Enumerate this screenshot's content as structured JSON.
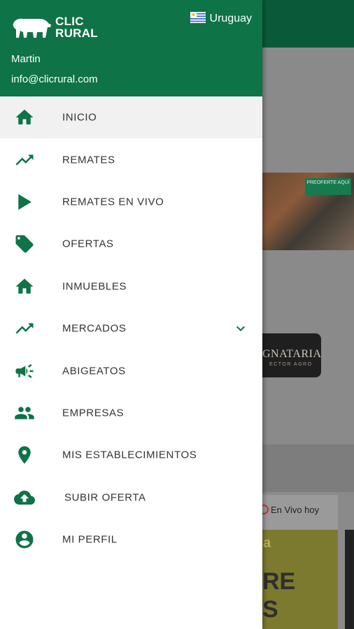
{
  "header": {
    "logo_line1": "CLIC",
    "logo_line2": "RURAL",
    "country": "Uruguay",
    "user_name": "Martin",
    "user_email": "info@clicrural.com"
  },
  "menu": {
    "items": [
      {
        "label": "INICIO",
        "icon": "home-icon"
      },
      {
        "label": "REMATES",
        "icon": "trending-up-icon"
      },
      {
        "label": "REMATES EN VIVO",
        "icon": "play-icon"
      },
      {
        "label": "OFERTAS",
        "icon": "tag-icon"
      },
      {
        "label": "INMUEBLES",
        "icon": "home-icon"
      },
      {
        "label": "MERCADOS",
        "icon": "trending-up-icon"
      },
      {
        "label": "ABIGEATOS",
        "icon": "megaphone-icon"
      },
      {
        "label": "EMPRESAS",
        "icon": "people-icon"
      },
      {
        "label": "MIS ESTABLECIMIENTOS",
        "icon": "location-pin-icon"
      },
      {
        "label": "SUBIR OFERTA",
        "icon": "cloud-upload-icon"
      },
      {
        "label": "MI PERFIL",
        "icon": "account-circle-icon"
      }
    ]
  },
  "background": {
    "banner_badge": "PREOFERTE AQUÍ",
    "logo_text": "GNATARIA",
    "logo_sub": "ECTOR AGRO",
    "live_label": "En Vivo hoy",
    "card_text1": "a",
    "card_text2": "RE\nS"
  },
  "colors": {
    "primary": "#0e7347",
    "icon": "#0e7347",
    "text": "#333333",
    "active_bg": "#f1f1f1"
  }
}
